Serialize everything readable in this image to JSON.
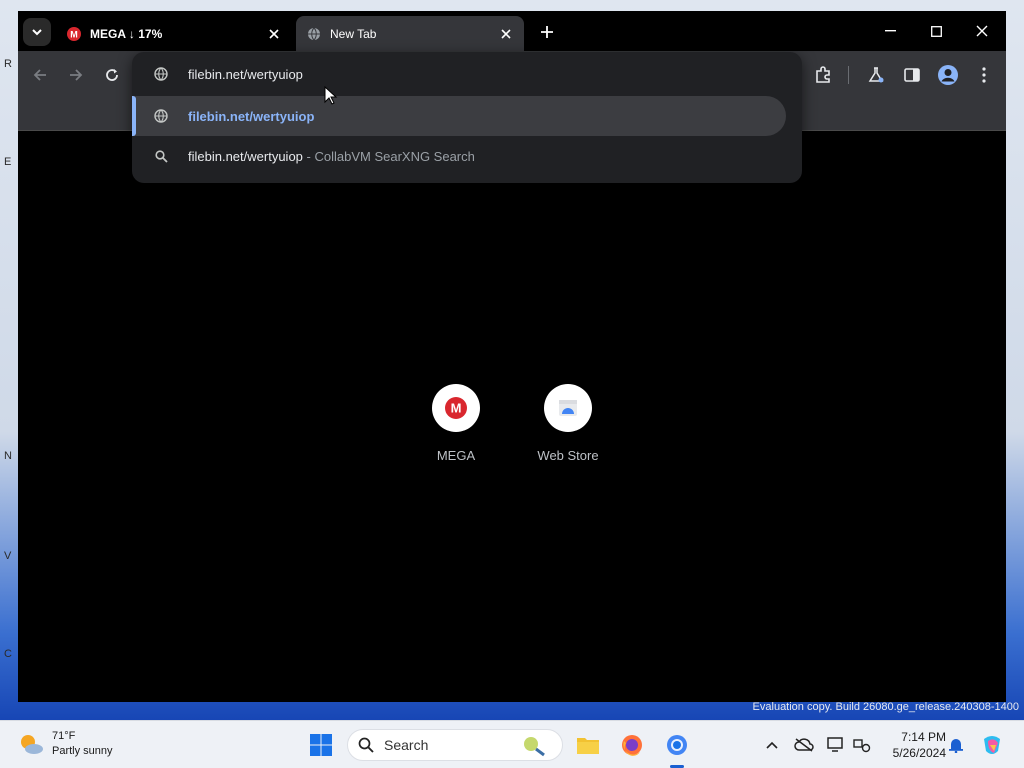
{
  "tabs": [
    {
      "title": "MEGA ↓ 17%",
      "favicon": "mega-icon",
      "active": false
    },
    {
      "title": "New Tab",
      "favicon": "globe-icon",
      "active": true
    }
  ],
  "omnibox": {
    "input_value": "filebin.net/wertyuiop",
    "suggestions": [
      {
        "text": "filebin.net/wertyuiop",
        "sub": "",
        "icon": "globe-icon",
        "selected": true
      },
      {
        "text": "filebin.net/wertyuiop",
        "sub": "- CollabVM SearXNG Search",
        "icon": "search-icon",
        "selected": false
      }
    ]
  },
  "shortcuts": [
    {
      "label": "MEGA",
      "icon": "mega-icon"
    },
    {
      "label": "Web Store",
      "icon": "web-store-icon"
    }
  ],
  "watermark": "Evaluation copy. Build 26080.ge_release.240308-1400",
  "taskbar": {
    "weather_temp": "71°F",
    "weather_desc": "Partly sunny",
    "search_label": "Search",
    "time": "7:14 PM",
    "date": "5/26/2024"
  },
  "colors": {
    "accent_blue": "#8ab4f8",
    "mega_red": "#d9272e",
    "browser_bg": "#000000",
    "toolbar_bg": "#35363a"
  }
}
